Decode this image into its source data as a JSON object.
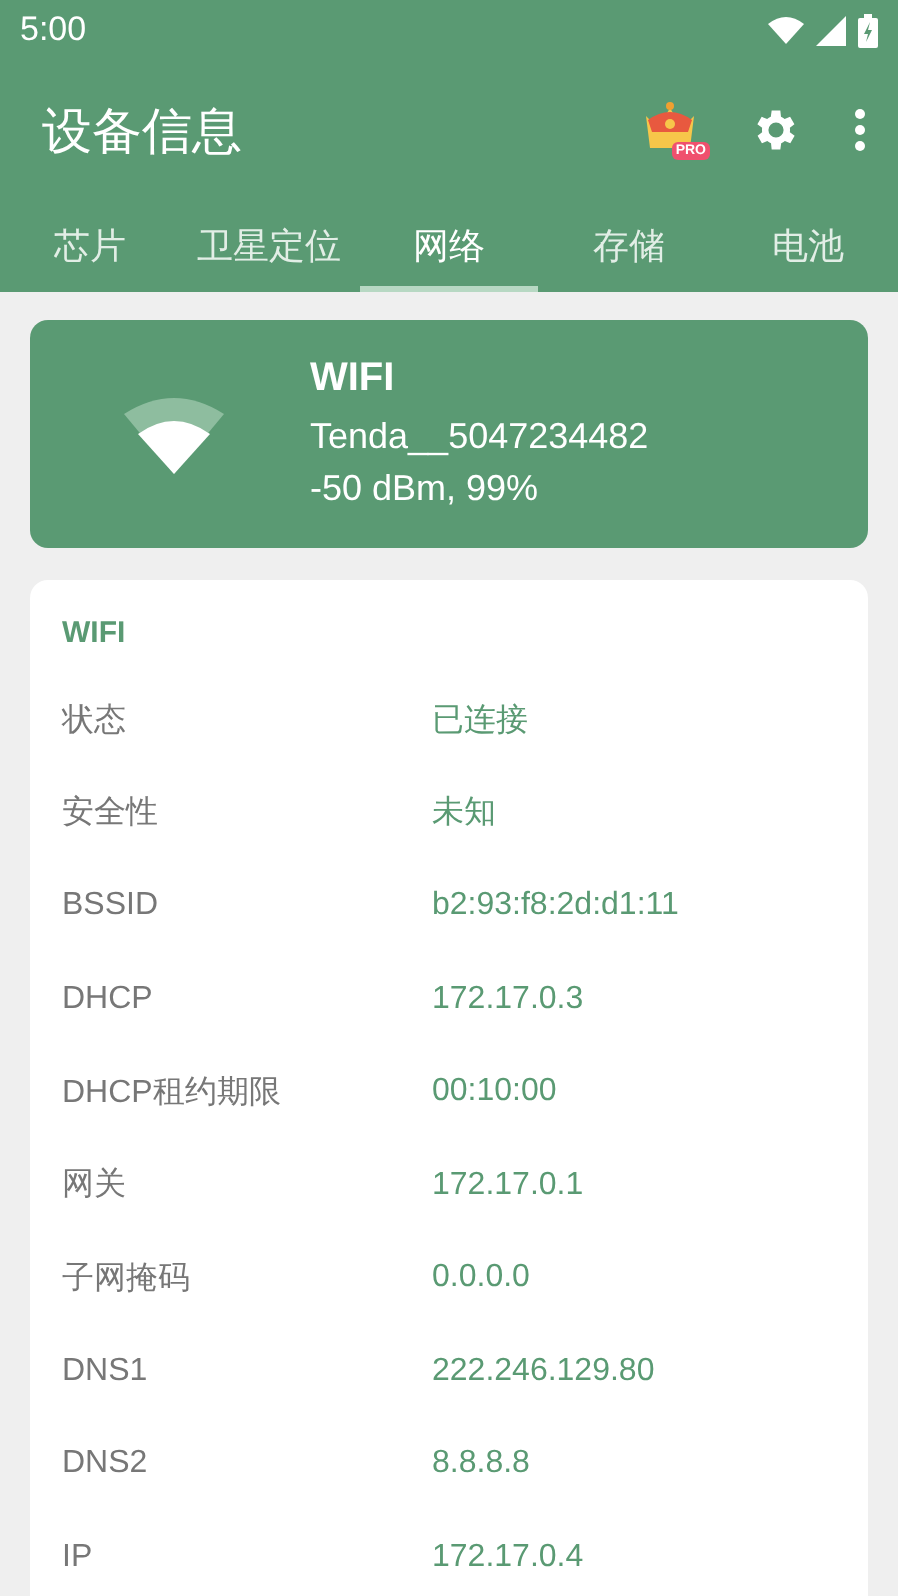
{
  "status_bar": {
    "time": "5:00"
  },
  "app_bar": {
    "title": "设备信息",
    "pro_badge": "PRO"
  },
  "tabs": [
    {
      "label": "芯片",
      "selected": false
    },
    {
      "label": "卫星定位",
      "selected": false
    },
    {
      "label": "网络",
      "selected": true
    },
    {
      "label": "存储",
      "selected": false
    },
    {
      "label": "电池",
      "selected": false
    }
  ],
  "summary": {
    "title": "WIFI",
    "ssid": "Tenda__5047234482",
    "signal": "-50 dBm, 99%"
  },
  "details": {
    "title": "WIFI",
    "rows": [
      {
        "label": "状态",
        "value": "已连接"
      },
      {
        "label": "安全性",
        "value": "未知"
      },
      {
        "label": "BSSID",
        "value": "b2:93:f8:2d:d1:11"
      },
      {
        "label": "DHCP",
        "value": "172.17.0.3"
      },
      {
        "label": "DHCP租约期限",
        "value": "00:10:00"
      },
      {
        "label": "网关",
        "value": "172.17.0.1"
      },
      {
        "label": "子网掩码",
        "value": "0.0.0.0"
      },
      {
        "label": "DNS1",
        "value": "222.246.129.80"
      },
      {
        "label": "DNS2",
        "value": "8.8.8.8"
      },
      {
        "label": "IP",
        "value": "172.17.0.4"
      }
    ]
  }
}
